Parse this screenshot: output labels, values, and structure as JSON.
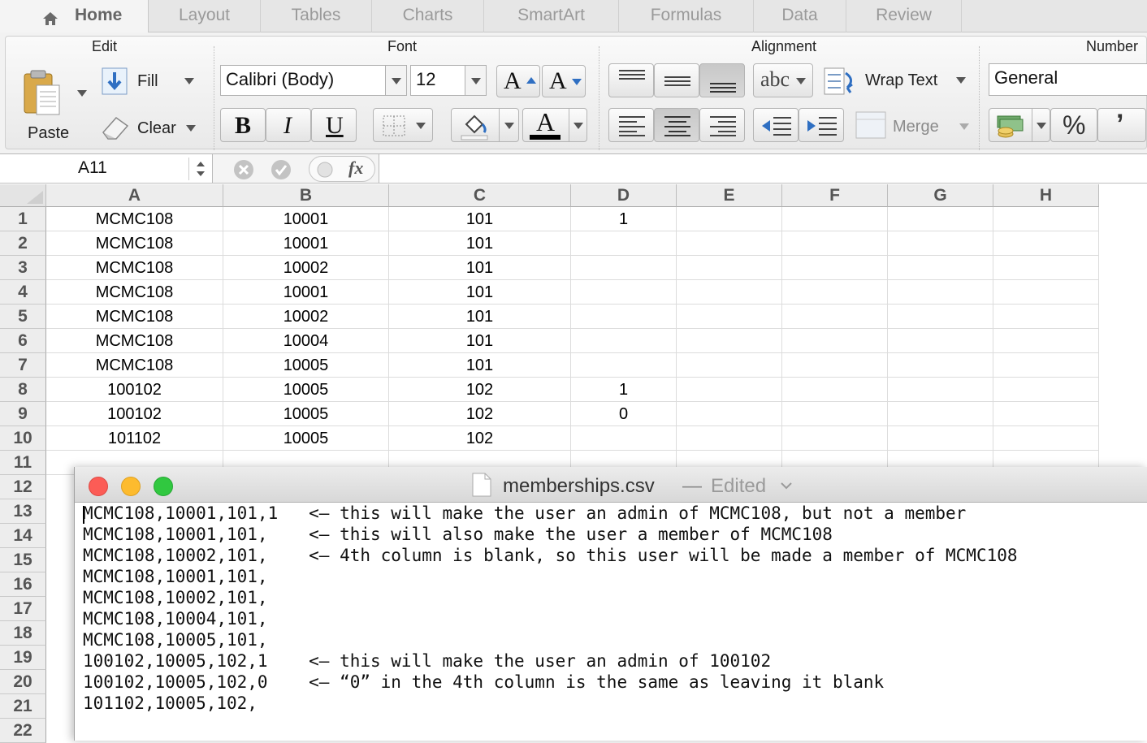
{
  "tabs": [
    {
      "label": "Home",
      "icon": "home-icon"
    },
    {
      "label": "Layout"
    },
    {
      "label": "Tables"
    },
    {
      "label": "Charts"
    },
    {
      "label": "SmartArt"
    },
    {
      "label": "Formulas"
    },
    {
      "label": "Data"
    },
    {
      "label": "Review"
    }
  ],
  "ribbon": {
    "edit": {
      "group": "Edit",
      "paste": "Paste",
      "fill": "Fill",
      "clear": "Clear"
    },
    "font": {
      "group": "Font",
      "family": "Calibri (Body)",
      "size": "12",
      "bold": "B",
      "italic": "I",
      "underline": "U",
      "grow": "A",
      "shrink": "A",
      "color": "A"
    },
    "alignment": {
      "group": "Alignment",
      "orientation": "abc",
      "wrap_text": "Wrap Text",
      "merge": "Merge"
    },
    "number": {
      "group": "Number",
      "format": "General",
      "percent": "%",
      "comma": "’"
    }
  },
  "formula_bar": {
    "cell_ref": "A11",
    "fx": "fx"
  },
  "sheet": {
    "columns": [
      "A",
      "B",
      "C",
      "D",
      "E",
      "F",
      "G",
      "H"
    ],
    "row_numbers": [
      "1",
      "2",
      "3",
      "4",
      "5",
      "6",
      "7",
      "8",
      "9",
      "10",
      "11",
      "12",
      "13",
      "14",
      "15",
      "16",
      "17",
      "18",
      "19",
      "20",
      "21",
      "22"
    ],
    "rows": [
      [
        "MCMC108",
        "10001",
        "101",
        "1"
      ],
      [
        "MCMC108",
        "10001",
        "101",
        ""
      ],
      [
        "MCMC108",
        "10002",
        "101",
        ""
      ],
      [
        "MCMC108",
        "10001",
        "101",
        ""
      ],
      [
        "MCMC108",
        "10002",
        "101",
        ""
      ],
      [
        "MCMC108",
        "10004",
        "101",
        ""
      ],
      [
        "MCMC108",
        "10005",
        "101",
        ""
      ],
      [
        "100102",
        "10005",
        "102",
        "1"
      ],
      [
        "100102",
        "10005",
        "102",
        "0"
      ],
      [
        "101102",
        "10005",
        "102",
        ""
      ]
    ]
  },
  "editor": {
    "filename": "memberships.csv",
    "separator": "—",
    "status": "Edited",
    "lines": [
      "MCMC108,10001,101,1   <– this will make the user an admin of MCMC108, but not a member",
      "MCMC108,10001,101,    <– this will also make the user a member of MCMC108",
      "MCMC108,10002,101,    <– 4th column is blank, so this user will be made a member of MCMC108",
      "MCMC108,10001,101,",
      "MCMC108,10002,101,",
      "MCMC108,10004,101,",
      "MCMC108,10005,101,",
      "100102,10005,102,1    <– this will make the user an admin of 100102",
      "100102,10005,102,0    <– “0” in the 4th column is the same as leaving it blank",
      "101102,10005,102,"
    ]
  },
  "colors": {
    "close": "#fc5c56",
    "minimize": "#fdbb2e",
    "zoom": "#31c840",
    "font_color_bar": "#000000"
  }
}
